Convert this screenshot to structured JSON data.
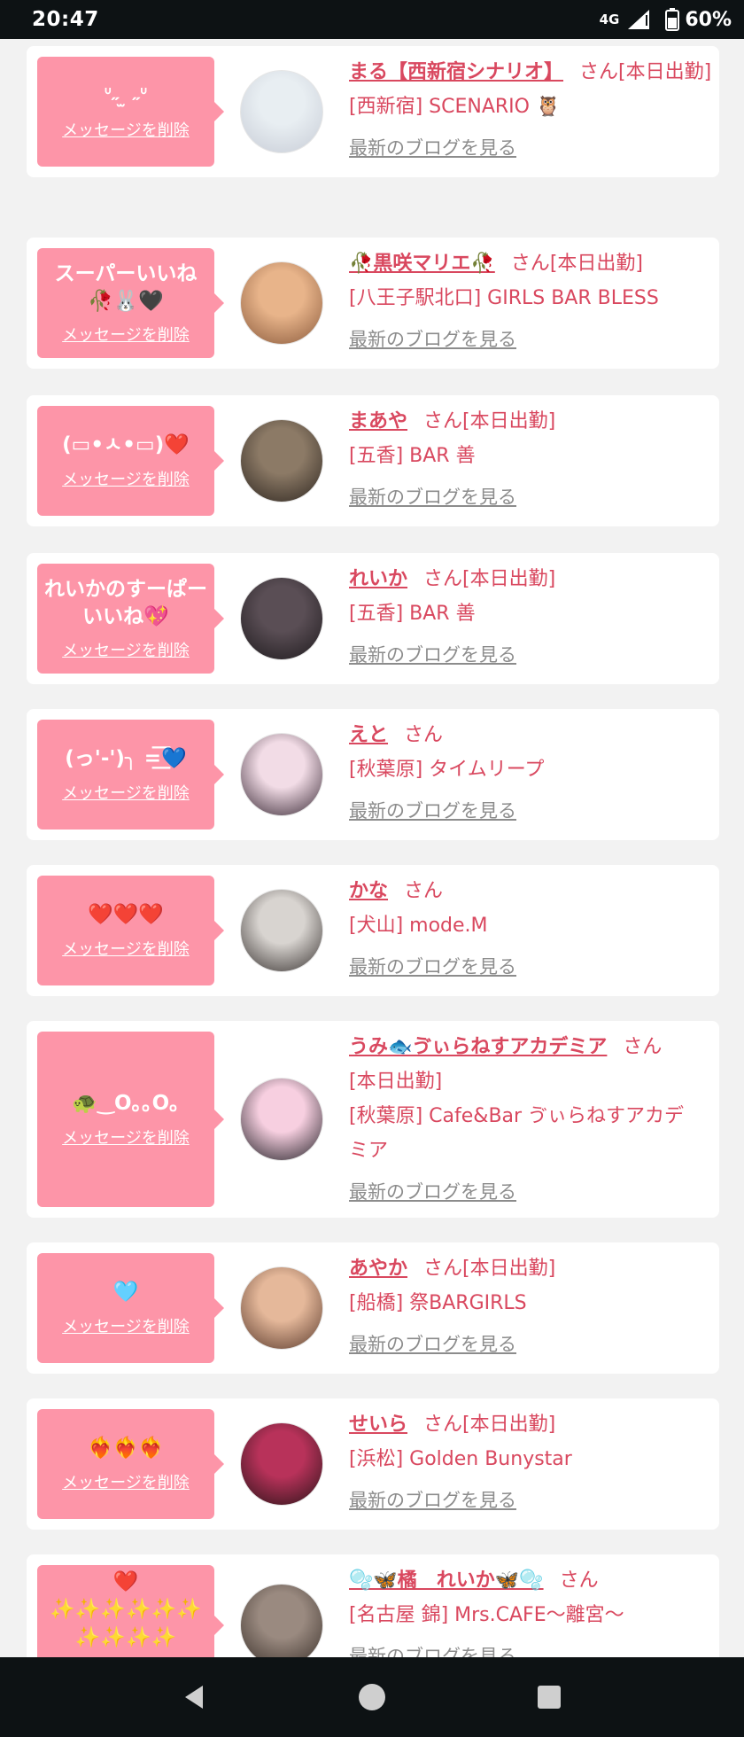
{
  "status": {
    "time": "20:47",
    "network": "4G",
    "battery": "60%"
  },
  "delete_label": "メッセージを削除",
  "blog_label": "最新のブログを見る",
  "san_label": "さん",
  "cards": [
    {
      "msg": "ᐡ˶ ̫ ˶ᐡ",
      "name": "まる【西新宿シナリオ】",
      "suffix": "[本日出勤]",
      "shop": "[西新宿] SCENARIO 🦉",
      "avatar_colors": [
        "#e8eef2",
        "#c7ccd6"
      ]
    },
    {
      "msg": "スーパーいいね🥀🐰🖤",
      "name": "🥀黒咲マリエ🥀",
      "suffix": "[本日出勤]",
      "shop": "[八王子駅北口] GIRLS BAR BLESS",
      "avatar_colors": [
        "#e8b48a",
        "#8a5a3c"
      ]
    },
    {
      "msg": "(▭•ㅅ•▭)❤️",
      "name": "まあや",
      "suffix": "[本日出勤]",
      "shop": "[五香] BAR 善",
      "avatar_colors": [
        "#8c7a66",
        "#2e2620"
      ]
    },
    {
      "msg": "れいかのすーぱーいいね💖",
      "name": "れいか",
      "suffix": "[本日出勤]",
      "shop": "[五香] BAR 善",
      "avatar_colors": [
        "#5a4e55",
        "#1e1a1d"
      ]
    },
    {
      "msg": "(っ'-')╮ =͟͟͞͞💙",
      "name": "えと",
      "suffix": "",
      "shop": "[秋葉原] タイムリープ",
      "avatar_colors": [
        "#f2dce6",
        "#3a2a36"
      ]
    },
    {
      "msg": "❤️❤️❤️",
      "name": "かな",
      "suffix": "",
      "shop": "[犬山] mode.M",
      "avatar_colors": [
        "#d8d4d0",
        "#3a3432"
      ]
    },
    {
      "msg": "🐢‿O｡｡O｡",
      "name": "うみ🐟ゔぃらねすアカデミア",
      "suffix": "",
      "shop_lines": [
        "[本日出勤]",
        "[秋葉原] Cafe&Bar ゔぃらねすアカデ",
        "ミア"
      ],
      "avatar_colors": [
        "#f7cfe0",
        "#222026"
      ]
    },
    {
      "msg": "🩵",
      "name": "あやか",
      "suffix": "[本日出勤]",
      "shop": "[船橋] 祭BARGIRLS",
      "avatar_colors": [
        "#e5b89a",
        "#5a3a2c"
      ]
    },
    {
      "msg": "❤️‍🔥❤️‍🔥❤️‍🔥",
      "name": "せいら",
      "suffix": "[本日出勤]",
      "shop": "[浜松] Golden Bunystar",
      "avatar_colors": [
        "#b8325a",
        "#2a1418"
      ]
    },
    {
      "msg": "❤️ ✨✨✨✨✨✨ ✨✨✨✨",
      "name": "🫧🦋橘　れいか🦋🫧",
      "suffix": "",
      "shop": "[名古屋 錦] Mrs.CAFE〜離宮〜",
      "avatar_colors": [
        "#9a8a80",
        "#3a302a"
      ]
    }
  ]
}
